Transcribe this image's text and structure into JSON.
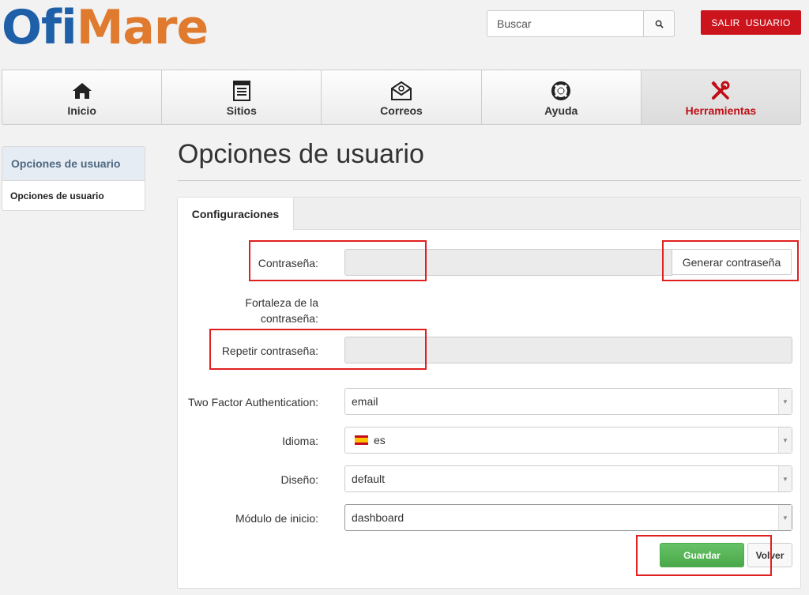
{
  "header": {
    "logo_part1": "Ofi",
    "logo_part2": "Mare",
    "search_placeholder": "Buscar",
    "logout_label": "SALIR  USUARIO",
    "accent_color": "#cc141d"
  },
  "nav": {
    "items": [
      {
        "label": "Inicio",
        "icon": "home-icon"
      },
      {
        "label": "Sitios",
        "icon": "document-list-icon"
      },
      {
        "label": "Correos",
        "icon": "email-icon"
      },
      {
        "label": "Ayuda",
        "icon": "lifebuoy-icon"
      },
      {
        "label": "Herramientas",
        "icon": "tools-icon",
        "active": true
      }
    ]
  },
  "sidebar": {
    "header": "Opciones de usuario",
    "items": [
      {
        "label": "Opciones de usuario"
      }
    ]
  },
  "page": {
    "title": "Opciones de usuario"
  },
  "panel": {
    "tab_label": "Configuraciones",
    "fields": {
      "password_label": "Contraseña:",
      "password_value": "",
      "generate_label": "Generar contraseña",
      "strength_label_line1": "Fortaleza de la",
      "strength_label_line2": "contraseña:",
      "repeat_label": "Repetir contraseña:",
      "repeat_value": "",
      "twofa_label": "Two Factor Authentication:",
      "twofa_value": "email",
      "language_label": "Idioma:",
      "language_value": "es",
      "design_label": "Diseño:",
      "design_value": "default",
      "start_module_label": "Módulo de inicio:",
      "start_module_value": "dashboard"
    },
    "save_label": "Guardar",
    "back_label": "Volver"
  }
}
